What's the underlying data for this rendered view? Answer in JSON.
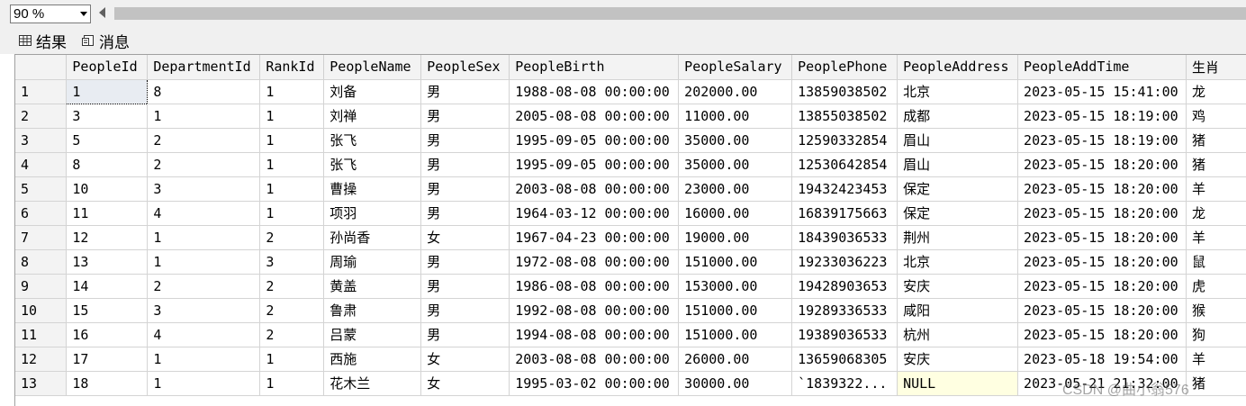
{
  "toolbar": {
    "zoom": "90 %"
  },
  "tabs": {
    "results": "结果",
    "messages": "消息"
  },
  "grid": {
    "columns": [
      "PeopleId",
      "DepartmentId",
      "RankId",
      "PeopleName",
      "PeopleSex",
      "PeopleBirth",
      "PeopleSalary",
      "PeoplePhone",
      "PeopleAddress",
      "PeopleAddTime",
      "生肖"
    ],
    "rows": [
      [
        "1",
        "1",
        "8",
        "1",
        "刘备",
        "男",
        "1988-08-08 00:00:00",
        "202000.00",
        "13859038502",
        "北京",
        "2023-05-15 15:41:00",
        "龙"
      ],
      [
        "2",
        "3",
        "1",
        "1",
        "刘禅",
        "男",
        "2005-08-08 00:00:00",
        "11000.00",
        "13855038502",
        "成都",
        "2023-05-15 18:19:00",
        "鸡"
      ],
      [
        "3",
        "5",
        "2",
        "1",
        "张飞",
        "男",
        "1995-09-05 00:00:00",
        "35000.00",
        "12590332854",
        "眉山",
        "2023-05-15 18:19:00",
        "猪"
      ],
      [
        "4",
        "8",
        "2",
        "1",
        "张飞",
        "男",
        "1995-09-05 00:00:00",
        "35000.00",
        "12530642854",
        "眉山",
        "2023-05-15 18:20:00",
        "猪"
      ],
      [
        "5",
        "10",
        "3",
        "1",
        "曹操",
        "男",
        "2003-08-08 00:00:00",
        "23000.00",
        "19432423453",
        "保定",
        "2023-05-15 18:20:00",
        "羊"
      ],
      [
        "6",
        "11",
        "4",
        "1",
        "项羽",
        "男",
        "1964-03-12 00:00:00",
        "16000.00",
        "16839175663",
        "保定",
        "2023-05-15 18:20:00",
        "龙"
      ],
      [
        "7",
        "12",
        "1",
        "2",
        "孙尚香",
        "女",
        "1967-04-23 00:00:00",
        "19000.00",
        "18439036533",
        "荆州",
        "2023-05-15 18:20:00",
        "羊"
      ],
      [
        "8",
        "13",
        "1",
        "3",
        "周瑜",
        "男",
        "1972-08-08 00:00:00",
        "151000.00",
        "19233036223",
        "北京",
        "2023-05-15 18:20:00",
        "鼠"
      ],
      [
        "9",
        "14",
        "2",
        "2",
        "黄盖",
        "男",
        "1986-08-08 00:00:00",
        "153000.00",
        "19428903653",
        "安庆",
        "2023-05-15 18:20:00",
        "虎"
      ],
      [
        "10",
        "15",
        "3",
        "2",
        "鲁肃",
        "男",
        "1992-08-08 00:00:00",
        "151000.00",
        "19289336533",
        "咸阳",
        "2023-05-15 18:20:00",
        "猴"
      ],
      [
        "11",
        "16",
        "4",
        "2",
        "吕蒙",
        "男",
        "1994-08-08 00:00:00",
        "151000.00",
        "19389036533",
        "杭州",
        "2023-05-15 18:20:00",
        "狗"
      ],
      [
        "12",
        "17",
        "1",
        "1",
        "西施",
        "女",
        "2003-08-08 00:00:00",
        "26000.00",
        "13659068305",
        "安庆",
        "2023-05-18 19:54:00",
        "羊"
      ],
      [
        "13",
        "18",
        "1",
        "1",
        "花木兰",
        "女",
        "1995-03-02 00:00:00",
        "30000.00",
        "`1839322...",
        "NULL",
        "2023-05-21 21:32:00",
        "猪"
      ]
    ]
  },
  "watermark": "CSDN @曲小翁576"
}
